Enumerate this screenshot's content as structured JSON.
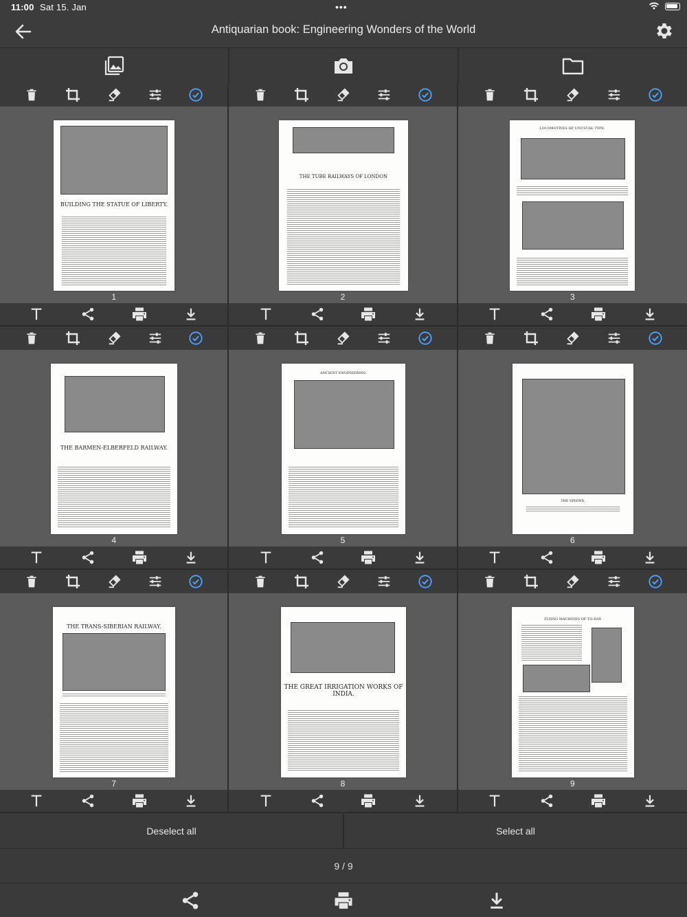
{
  "status": {
    "time": "11:00",
    "date": "Sat 15. Jan",
    "dots": "•••"
  },
  "nav": {
    "title": "Antiquarian book: Engineering Wonders of the World"
  },
  "sources": [
    "gallery-icon",
    "camera-icon",
    "folder-icon"
  ],
  "colors": {
    "accent": "#4aa3ff",
    "background": "#3a3a3a",
    "page_area": "#5b5b5b",
    "icon": "#e6e6e6"
  },
  "pages": [
    {
      "number": "1",
      "heading": "BUILDING THE STATUE OF LIBERTY.",
      "selected": true
    },
    {
      "number": "2",
      "heading": "THE TUBE RAILWAYS OF LONDON",
      "selected": true
    },
    {
      "number": "3",
      "heading": "LOCOMOTIVES OF UNUSUAL TYPE.",
      "selected": true
    },
    {
      "number": "4",
      "heading": "THE BARMEN-ELBERFELD RAILWAY.",
      "selected": true
    },
    {
      "number": "5",
      "heading": "ANCIENT ENGINEERING.",
      "selected": true
    },
    {
      "number": "6",
      "heading": "THE SPHINX.",
      "selected": true
    },
    {
      "number": "7",
      "heading": "THE TRANS-SIBERIAN RAILWAY.",
      "selected": true
    },
    {
      "number": "8",
      "heading": "THE GREAT IRRIGATION WORKS OF INDIA.",
      "selected": true
    },
    {
      "number": "9",
      "heading": "FLYING MACHINES OF TO-DAY.",
      "selected": true
    }
  ],
  "page_tools_top": [
    "delete-icon",
    "crop-icon",
    "eraser-icon",
    "adjust-icon",
    "check-icon"
  ],
  "page_tools_bottom": [
    "text-icon",
    "share-icon",
    "print-icon",
    "download-icon"
  ],
  "selection": {
    "deselect_all": "Deselect all",
    "select_all": "Select all"
  },
  "counter": "9 / 9",
  "bottom_actions": [
    "share-icon",
    "print-icon",
    "download-icon"
  ]
}
